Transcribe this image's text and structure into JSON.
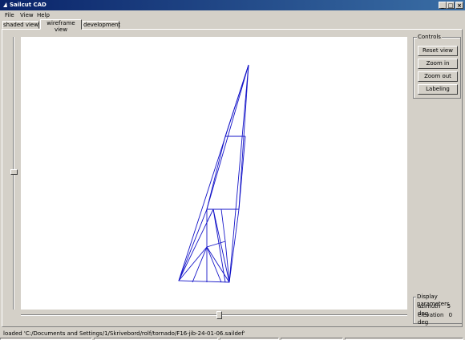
{
  "window": {
    "title": "Sailcut CAD"
  },
  "menu": {
    "items": [
      "File",
      "View",
      "Help"
    ]
  },
  "tabs": [
    "shaded view",
    "wireframe view",
    "development"
  ],
  "controls": {
    "title": "Controls",
    "buttons": [
      "Reset view",
      "Zoom in",
      "Zoom out",
      "Labeling"
    ]
  },
  "display_parameters": {
    "title": "Display parameters",
    "azimuth_label": "azimuth",
    "azimuth_value": "5 deg",
    "elevation_label": "elevation",
    "elevation_value": "0 deg"
  },
  "status": {
    "text": "loaded 'C:/Documents and Settings/1/Skrivebord/rolf/tornado/F16-jib-24-01-06.saildef'"
  },
  "colors": {
    "wire": "#1414c8",
    "titlebar": "#0a246a"
  }
}
